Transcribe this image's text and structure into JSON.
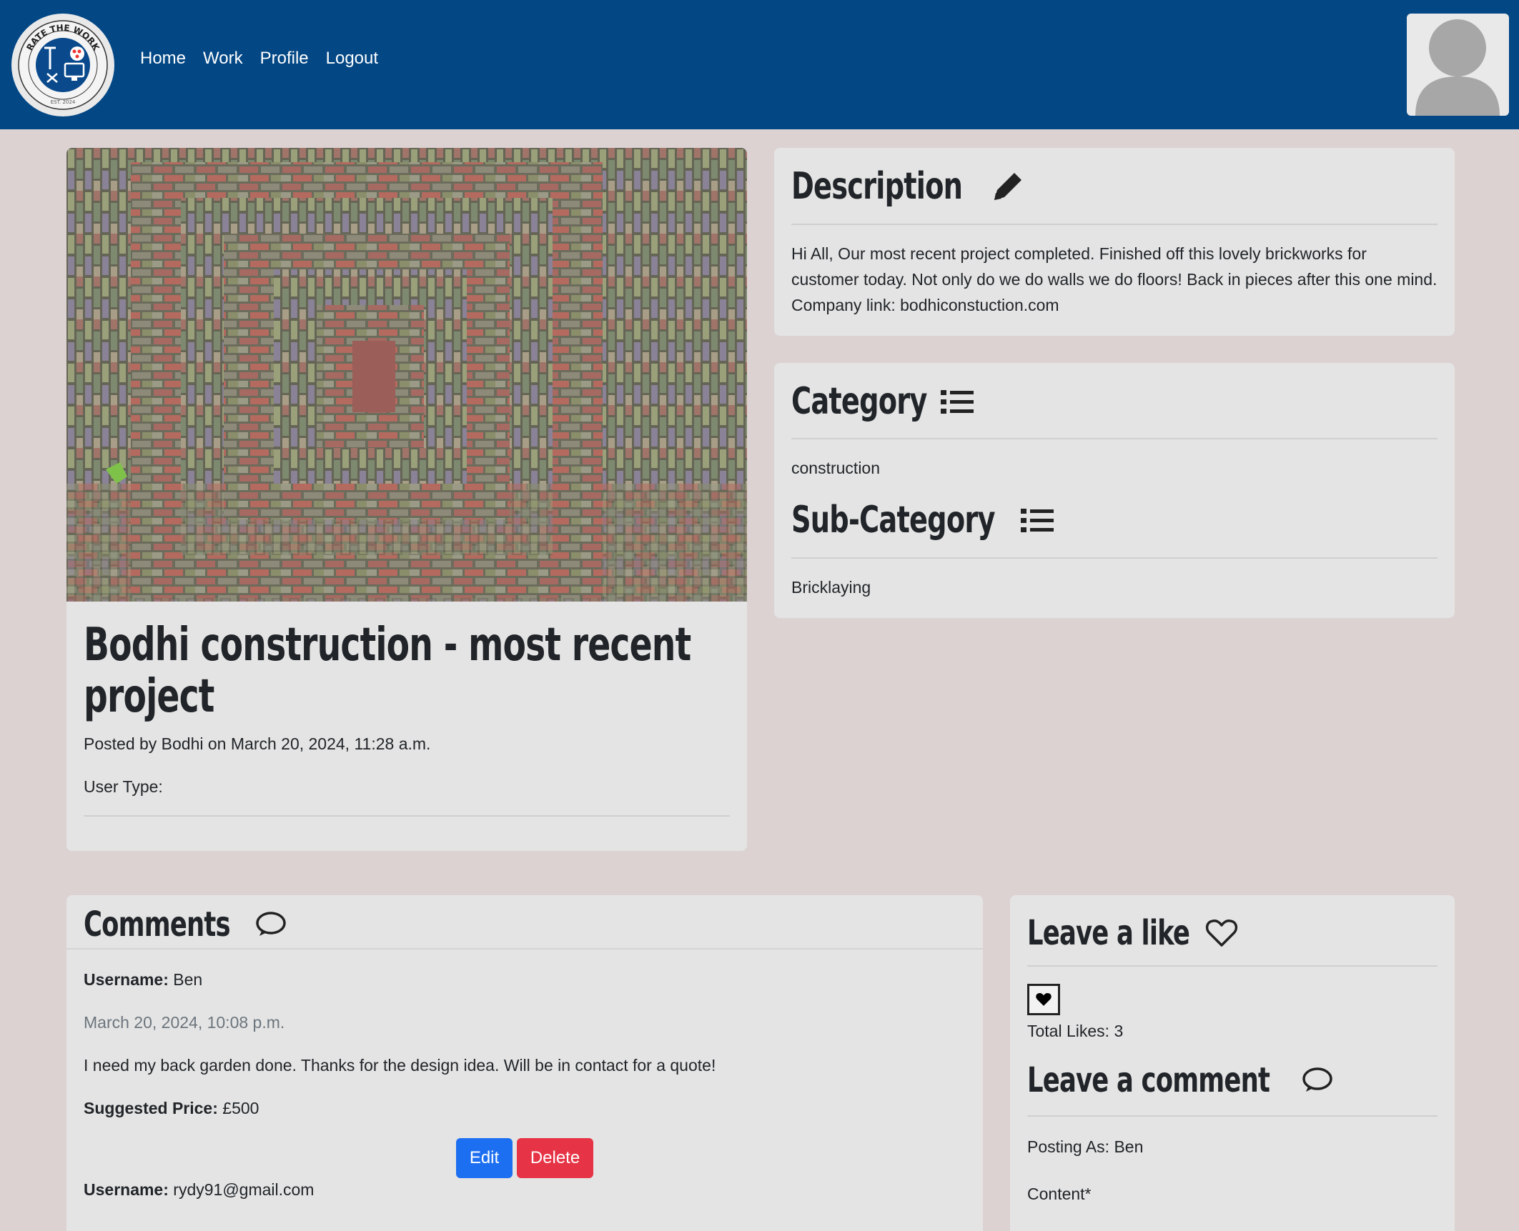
{
  "nav": {
    "logo_text": "RATE THE WORK",
    "logo_est": "EST. 2024",
    "links": [
      "Home",
      "Work",
      "Profile",
      "Logout"
    ]
  },
  "post": {
    "title": "Bodhi construction - most recent project",
    "posted_by": "Posted by Bodhi on March 20, 2024, 11:28 a.m.",
    "user_type": "User Type:"
  },
  "description": {
    "heading": "Description",
    "text": "Hi All, Our most recent project completed. Finished off this lovely brickworks for customer today. Not only do we do walls we do floors! Back in pieces after this one mind. Company link: bodhiconstuction.com"
  },
  "category": {
    "heading": "Category",
    "value": "construction",
    "sub_heading": "Sub-Category",
    "sub_value": "Bricklaying"
  },
  "comments": {
    "heading": "Comments",
    "items": [
      {
        "username_label": "Username:",
        "username": "Ben",
        "date": "March 20, 2024, 10:08 p.m.",
        "text": "I need my back garden done. Thanks for the design idea. Will be in contact for a quote!",
        "price_label": "Suggested Price:",
        "price": "£500",
        "edit_label": "Edit",
        "delete_label": "Delete"
      },
      {
        "username_label": "Username:",
        "username": "rydy91@gmail.com"
      }
    ]
  },
  "like": {
    "heading": "Leave a like",
    "total": "Total Likes: 3"
  },
  "leave_comment": {
    "heading": "Leave a comment",
    "posting_as": "Posting As: Ben",
    "content_label": "Content*"
  },
  "colors": {
    "navbar": "#034785",
    "page_bg": "#dcd2d2",
    "card_bg": "#e4e4e4",
    "edit_button": "#1d6ff2",
    "delete_button": "#e63446"
  }
}
